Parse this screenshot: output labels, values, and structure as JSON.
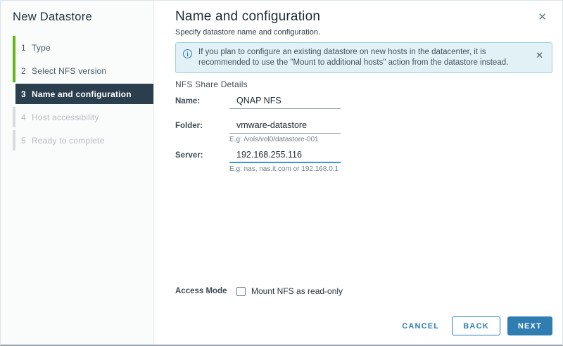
{
  "window": {
    "close_icon": "✕"
  },
  "sidebar": {
    "title": "New Datastore",
    "steps": [
      {
        "num": "1",
        "label": "Type",
        "state": "done"
      },
      {
        "num": "2",
        "label": "Select NFS version",
        "state": "done"
      },
      {
        "num": "3",
        "label": "Name and configuration",
        "state": "active"
      },
      {
        "num": "4",
        "label": "Host accessibility",
        "state": "upcoming"
      },
      {
        "num": "5",
        "label": "Ready to complete",
        "state": "upcoming"
      }
    ]
  },
  "header": {
    "title": "Name and configuration",
    "subtitle": "Specify datastore name and configuration."
  },
  "banner": {
    "icon": "i",
    "text": "If you plan to configure an existing datastore on new hosts in the datacenter, it is recommended to use the \"Mount to additional hosts\" action from the datastore instead.",
    "close_icon": "✕"
  },
  "form": {
    "section_title": "NFS Share Details",
    "fields": [
      {
        "label": "Name:",
        "value": "QNAP NFS",
        "hint": ""
      },
      {
        "label": "Folder:",
        "value": "vmware-datastore",
        "hint": "E.g: /vols/vol0/datastore-001"
      },
      {
        "label": "Server:",
        "value": "192.168.255.116",
        "hint": "E.g: nas, nas.it.com or 192.168.0.1",
        "focused": true
      }
    ],
    "access_mode": {
      "label": "Access Mode",
      "checkbox_label": "Mount NFS as read-only",
      "checked": false
    }
  },
  "footer": {
    "cancel": "CANCEL",
    "back": "BACK",
    "next": "NEXT"
  },
  "colors": {
    "accent_blue": "#2b7cb5",
    "primary_button": "#2f7db1",
    "step_done_green": "#61b715",
    "step_upcoming_gray": "#d9dcde",
    "active_step_bg": "#2b3e4e",
    "banner_bg": "#e1f1f6",
    "banner_border": "#a2cfe2",
    "focus_underline": "#2e9bd6"
  }
}
